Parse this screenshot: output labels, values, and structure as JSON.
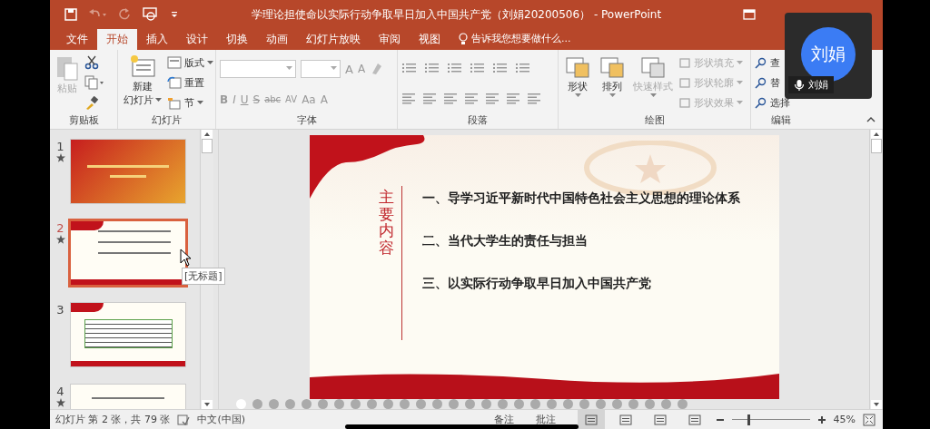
{
  "title_bar": {
    "title": "学理论担使命以实际行动争取早日加入中国共产党（刘娟20200506） - PowerPoint"
  },
  "tabs": [
    {
      "label": "文件",
      "selected": false
    },
    {
      "label": "开始",
      "selected": true
    },
    {
      "label": "插入",
      "selected": false
    },
    {
      "label": "设计",
      "selected": false
    },
    {
      "label": "切换",
      "selected": false
    },
    {
      "label": "动画",
      "selected": false
    },
    {
      "label": "幻灯片放映",
      "selected": false
    },
    {
      "label": "审阅",
      "selected": false
    },
    {
      "label": "视图",
      "selected": false
    }
  ],
  "tell_me": "告诉我您想要做什么...",
  "ribbon": {
    "groups": [
      {
        "kind": "clipboard",
        "label": "剪贴板",
        "paste": {
          "label": "粘贴",
          "disabled": true
        }
      },
      {
        "kind": "slides",
        "label": "幻灯片",
        "new_slide": [
          "新建",
          "幻灯片"
        ],
        "layout": "版式",
        "reset": "重置",
        "section": "节"
      },
      {
        "kind": "font",
        "label": "字体",
        "size_buttons": [
          "A",
          "A"
        ],
        "format_buttons": [
          "B",
          "I",
          "U",
          "S",
          "abc",
          "AV",
          "Aa",
          "A"
        ]
      },
      {
        "kind": "paragraph",
        "label": "段落"
      },
      {
        "kind": "drawing",
        "label": "绘图",
        "large": [
          {
            "label": "形状",
            "disabled": false
          },
          {
            "label": "排列",
            "disabled": false
          },
          {
            "label": "快速样式",
            "disabled": true
          }
        ],
        "small": [
          {
            "label": "形状填充",
            "disabled": true
          },
          {
            "label": "形状轮廓",
            "disabled": true
          },
          {
            "label": "形状效果",
            "disabled": true
          }
        ]
      },
      {
        "kind": "editing",
        "label": "编辑",
        "items": [
          "查",
          "替",
          "选择"
        ]
      }
    ]
  },
  "thumbnails": [
    {
      "number": "1",
      "starred": true,
      "selected": false,
      "kind": "title"
    },
    {
      "number": "2",
      "starred": true,
      "selected": true,
      "kind": "list"
    },
    {
      "number": "3",
      "starred": false,
      "selected": false,
      "kind": "text"
    },
    {
      "number": "4",
      "starred": true,
      "selected": false,
      "kind": "plain"
    }
  ],
  "tooltip": "[无标题]",
  "slide": {
    "heading": "主要内容",
    "items": [
      "一、导学习近平新时代中国特色社会主义思想的理论体系",
      "二、当代大学生的责任与担当",
      "三、以实际行动争取早日加入中国共产党"
    ]
  },
  "page_dots": [
    {
      "selected": true
    },
    {
      "selected": false
    },
    {
      "selected": false
    },
    {
      "selected": false
    },
    {
      "selected": false
    },
    {
      "selected": false
    },
    {
      "selected": false
    },
    {
      "selected": false
    },
    {
      "selected": false
    },
    {
      "selected": false
    },
    {
      "selected": false
    },
    {
      "selected": false
    },
    {
      "selected": false
    },
    {
      "selected": false
    },
    {
      "selected": false
    },
    {
      "selected": false
    },
    {
      "selected": false
    },
    {
      "selected": false
    },
    {
      "selected": false
    },
    {
      "selected": false
    },
    {
      "selected": false
    },
    {
      "selected": false
    },
    {
      "selected": false
    },
    {
      "selected": false
    },
    {
      "selected": false
    },
    {
      "selected": false
    },
    {
      "selected": false
    },
    {
      "selected": false
    }
  ],
  "status_bar": {
    "slide_info": "幻灯片 第 2 张，共 79 张",
    "language": "中文(中国)",
    "notes": "备注",
    "comments": "批注",
    "views": [
      {
        "selected": true
      },
      {
        "selected": false
      },
      {
        "selected": false
      },
      {
        "selected": false
      }
    ],
    "zoom": {
      "level": 0.2,
      "reading": "45%"
    }
  },
  "video_tile": {
    "avatar_text": "刘娟",
    "name": "刘娟",
    "muted": false
  }
}
